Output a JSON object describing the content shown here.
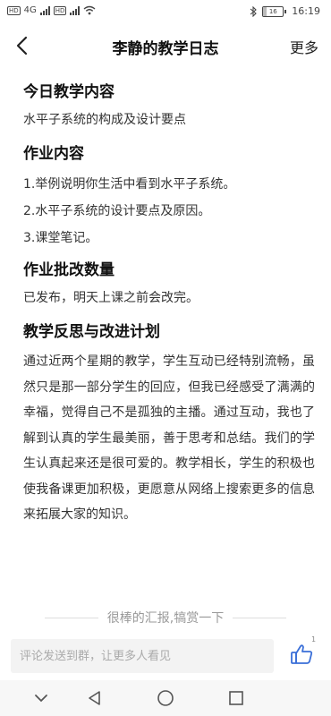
{
  "status_bar": {
    "time": "16:19",
    "battery": "16",
    "battery_level": 0.16,
    "network": "4G"
  },
  "header": {
    "title": "李静的教学日志",
    "more_label": "更多"
  },
  "sections": {
    "today": {
      "title": "今日教学内容",
      "text": "水平子系统的构成及设计要点"
    },
    "homework": {
      "title": "作业内容",
      "items": [
        "1.举例说明你生活中看到水平子系统。",
        "2.水平子系统的设计要点及原因。",
        "3.课堂笔记。"
      ]
    },
    "grading": {
      "title": "作业批改数量",
      "text": "已发布，明天上课之前会改完。"
    },
    "reflection": {
      "title": "教学反思与改进计划",
      "text": "通过近两个星期的教学，学生互动已经特别流畅，虽然只是那一部分学生的回应，但我已经感受了满满的幸福，觉得自己不是孤独的主播。通过互动，我也了解到认真的学生最美丽，善于思考和总结。我们的学生认真起来还是很可爱的。教学相长，学生的积极也使我备课更加积极，更愿意从网络上搜索更多的信息来拓展大家的知识。"
    }
  },
  "reward": {
    "label": "很棒的汇报,犒赏一下"
  },
  "comment": {
    "placeholder": "评论发送到群，让更多人看见",
    "value": ""
  },
  "like": {
    "count": "1"
  },
  "icons": {
    "back": "back-arrow-icon",
    "like": "thumbs-up-icon",
    "nav_down": "chevron-down-icon",
    "nav_back": "triangle-back-icon",
    "nav_home": "circle-home-icon",
    "nav_recent": "square-recent-icon"
  },
  "colors": {
    "accent": "#3a6fd8",
    "text": "#333333",
    "muted": "#999999"
  }
}
